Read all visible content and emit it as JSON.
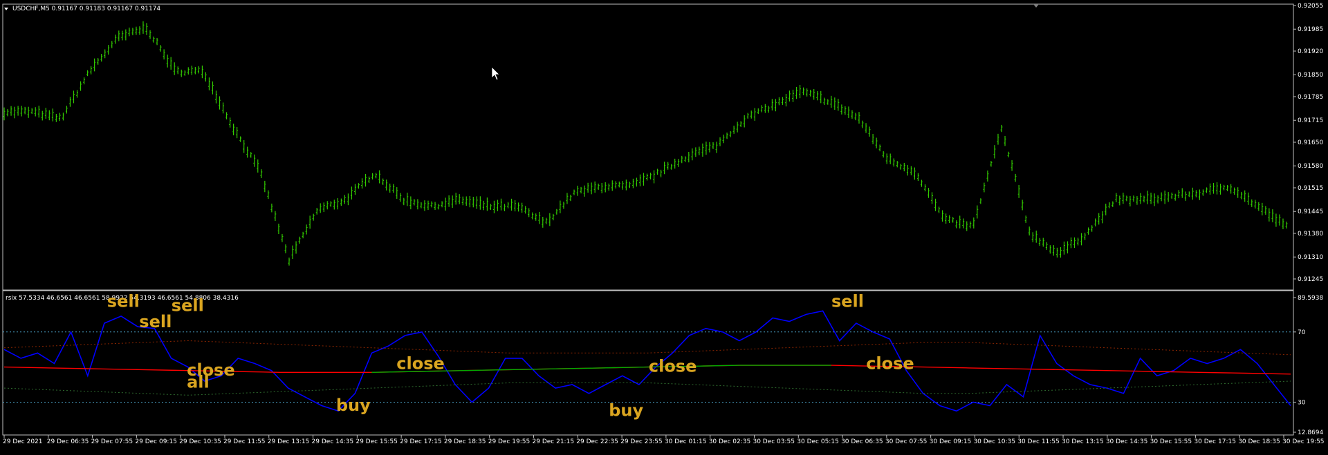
{
  "price_panel": {
    "header": "USDCHF,M5  0.91167 0.91183 0.91167 0.91174",
    "y_axis": {
      "labels": [
        "0.92055",
        "0.91985",
        "0.91920",
        "0.91850",
        "0.91785",
        "0.91715",
        "0.91650",
        "0.91580",
        "0.91515",
        "0.91445",
        "0.91380",
        "0.91310",
        "0.91245"
      ]
    }
  },
  "indicator_panel": {
    "header": "rsix 57.5334 46.6561 46.6561 58.9922 54.3193 46.6561 54.8806 38.4316",
    "y_axis": {
      "labels": [
        "89.5938",
        "70",
        "30",
        "12.8694"
      ]
    },
    "signals": [
      {
        "text": "sell",
        "x": 0.105,
        "y": 0.78
      },
      {
        "text": "sell",
        "x": 0.13,
        "y": 0.86
      },
      {
        "text": "sell",
        "x": 0.08,
        "y": 0.93
      },
      {
        "text": "close",
        "x": 0.142,
        "y": 0.42
      },
      {
        "text": "all",
        "x": 0.142,
        "y": 0.33
      },
      {
        "text": "buy",
        "x": 0.258,
        "y": 0.16
      },
      {
        "text": "close",
        "x": 0.305,
        "y": 0.47
      },
      {
        "text": "buy",
        "x": 0.47,
        "y": 0.12
      },
      {
        "text": "close",
        "x": 0.501,
        "y": 0.45
      },
      {
        "text": "sell",
        "x": 0.643,
        "y": 0.93
      },
      {
        "text": "close",
        "x": 0.67,
        "y": 0.47
      }
    ]
  },
  "time_axis": {
    "labels": [
      "29 Dec 2021",
      "29 Dec 06:35",
      "29 Dec 07:55",
      "29 Dec 09:15",
      "29 Dec 10:35",
      "29 Dec 11:55",
      "29 Dec 13:15",
      "29 Dec 14:35",
      "29 Dec 15:55",
      "29 Dec 17:15",
      "29 Dec 18:35",
      "29 Dec 19:55",
      "29 Dec 21:15",
      "29 Dec 22:35",
      "29 Dec 23:55",
      "30 Dec 01:15",
      "30 Dec 02:35",
      "30 Dec 03:55",
      "30 Dec 05:15",
      "30 Dec 06:35",
      "30 Dec 07:55",
      "30 Dec 09:15",
      "30 Dec 10:35",
      "30 Dec 11:55",
      "30 Dec 13:15",
      "30 Dec 14:35",
      "30 Dec 15:55",
      "30 Dec 17:15",
      "30 Dec 18:35",
      "30 Dec 19:55"
    ]
  },
  "chart_data": [
    {
      "type": "line",
      "title": "USDCHF,M5",
      "x": [
        "29 Dec 2021",
        "29 Dec 06:35",
        "29 Dec 07:55",
        "29 Dec 09:15",
        "29 Dec 10:35",
        "29 Dec 11:55",
        "29 Dec 13:15",
        "29 Dec 14:35",
        "29 Dec 15:55",
        "29 Dec 17:15",
        "29 Dec 18:35",
        "29 Dec 19:55",
        "29 Dec 21:15",
        "29 Dec 22:35",
        "29 Dec 23:55",
        "30 Dec 01:15",
        "30 Dec 02:35",
        "30 Dec 03:55",
        "30 Dec 05:15",
        "30 Dec 06:35",
        "30 Dec 07:55",
        "30 Dec 09:15",
        "30 Dec 10:35",
        "30 Dec 11:55",
        "30 Dec 13:15",
        "30 Dec 14:35",
        "30 Dec 15:55",
        "30 Dec 17:15",
        "30 Dec 18:35",
        "30 Dec 19:55"
      ],
      "series": [
        {
          "values": [
            0.9174,
            0.9174,
            0.9172,
            0.9186,
            0.9196,
            0.9199,
            0.9186,
            0.9186,
            0.917,
            0.9156,
            0.913,
            0.9145,
            0.9148,
            0.9156,
            0.9148,
            0.9146,
            0.9148,
            0.9146,
            0.9146,
            0.9141,
            0.915,
            0.9152,
            0.9152,
            0.9156,
            0.9161,
            0.9164,
            0.9172,
            0.9176,
            0.918,
            0.9177,
            0.9172,
            0.916,
            0.9156,
            0.9142,
            0.914,
            0.9169,
            0.9138,
            0.9132,
            0.9138,
            0.9148,
            0.9148,
            0.9149,
            0.915,
            0.9152,
            0.9146,
            0.914
          ],
          "color": "#33cc00"
        }
      ],
      "ylim": [
        0.91245,
        0.92055
      ],
      "grid": false
    },
    {
      "type": "line",
      "title": "rsix",
      "x": [
        "29 Dec 2021",
        "29 Dec 06:35",
        "29 Dec 07:55",
        "29 Dec 09:15",
        "29 Dec 10:35",
        "29 Dec 11:55",
        "29 Dec 13:15",
        "29 Dec 14:35",
        "29 Dec 15:55",
        "29 Dec 17:15",
        "29 Dec 18:35",
        "29 Dec 19:55",
        "29 Dec 21:15",
        "29 Dec 22:35",
        "29 Dec 23:55",
        "30 Dec 01:15",
        "30 Dec 02:35",
        "30 Dec 03:55",
        "30 Dec 05:15",
        "30 Dec 06:35",
        "30 Dec 07:55",
        "30 Dec 09:15",
        "30 Dec 10:35",
        "30 Dec 11:55",
        "30 Dec 13:15",
        "30 Dec 14:35",
        "30 Dec 15:55",
        "30 Dec 17:15",
        "30 Dec 18:35",
        "30 Dec 19:55"
      ],
      "series": [
        {
          "values": [
            60,
            55,
            58,
            52,
            70,
            45,
            75,
            79,
            73,
            72,
            55,
            50,
            42,
            45,
            55,
            52,
            48,
            38,
            33,
            28,
            25,
            35,
            58,
            62,
            68,
            70,
            56,
            40,
            30,
            38,
            55,
            55,
            45,
            38,
            40,
            35,
            40,
            45,
            40,
            50,
            58,
            68,
            72,
            70,
            65,
            70,
            78,
            76,
            80,
            82,
            65,
            75,
            70,
            66,
            48,
            35,
            28,
            25,
            30,
            28,
            40,
            33,
            68,
            52,
            45,
            40,
            38,
            35,
            55,
            45,
            48,
            55,
            52,
            55,
            60,
            52,
            40,
            28
          ],
          "color": "#0000ff"
        },
        {
          "values": [
            50,
            49.5,
            49,
            48.5,
            48,
            47.5,
            47,
            47,
            47,
            47.5,
            48,
            48.5,
            49,
            49.5,
            50,
            50.5,
            51,
            51,
            51,
            50.5,
            50,
            49.5,
            49,
            48.5,
            48,
            47.5,
            47,
            46.5,
            46
          ],
          "color": "#ff0000"
        },
        {
          "values": [
            61,
            62,
            63,
            64,
            65,
            64,
            63,
            62,
            61,
            60,
            59,
            58,
            58,
            58,
            58,
            59,
            60,
            61,
            62,
            63,
            64,
            64,
            63,
            62,
            61,
            60,
            59,
            58,
            57
          ],
          "color": "#8b2500"
        },
        {
          "values": [
            38,
            37,
            36,
            35,
            34,
            35,
            36,
            37,
            38,
            39,
            40,
            41,
            41,
            41,
            41,
            40,
            39,
            38,
            37,
            36,
            35,
            35,
            36,
            37,
            38,
            39,
            40,
            41,
            42
          ],
          "color": "#2e6b2e"
        }
      ],
      "ylim": [
        12.8694,
        89.5938
      ],
      "levels": [
        70,
        30
      ],
      "grid": false
    }
  ]
}
